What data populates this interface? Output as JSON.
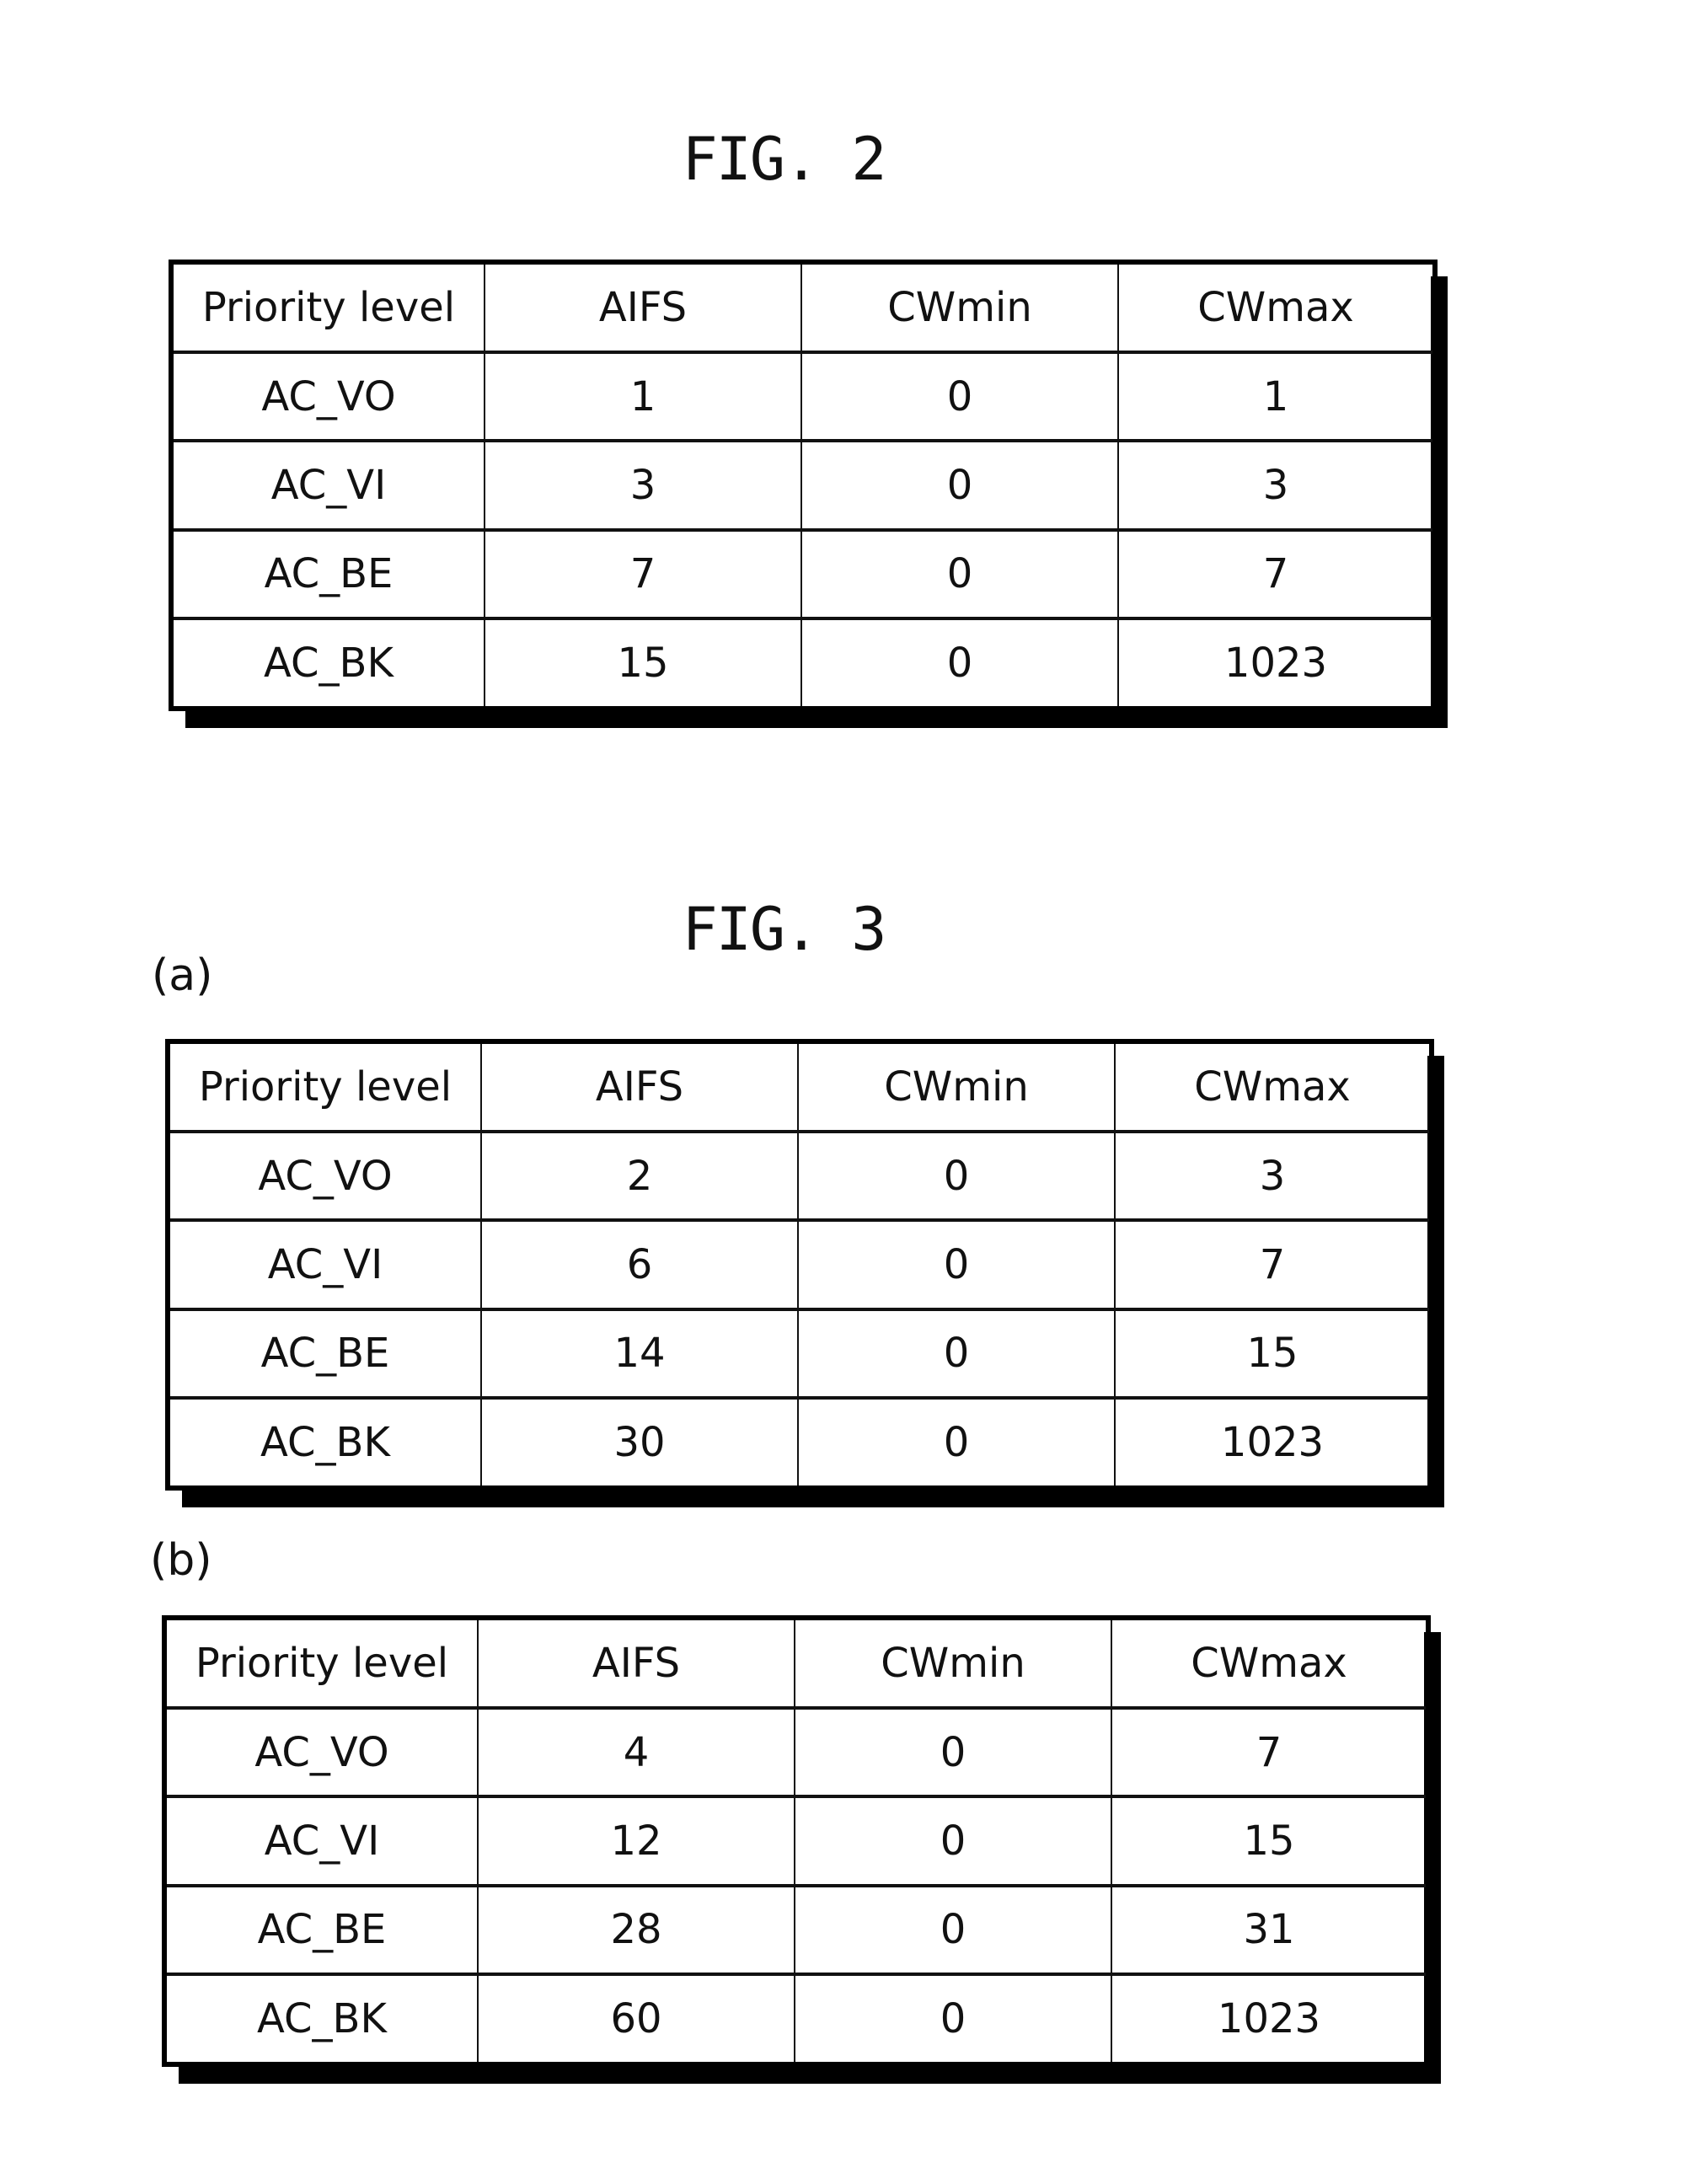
{
  "figures": [
    {
      "title": "FIG. 2",
      "panels": [
        {
          "label": "",
          "headers": [
            "Priority level",
            "AIFS",
            "CWmin",
            "CWmax"
          ],
          "rows": [
            [
              "AC_VO",
              "1",
              "0",
              "1"
            ],
            [
              "AC_VI",
              "3",
              "0",
              "3"
            ],
            [
              "AC_BE",
              "7",
              "0",
              "7"
            ],
            [
              "AC_BK",
              "15",
              "0",
              "1023"
            ]
          ]
        }
      ]
    },
    {
      "title": "FIG. 3",
      "panels": [
        {
          "label": "(a)",
          "headers": [
            "Priority level",
            "AIFS",
            "CWmin",
            "CWmax"
          ],
          "rows": [
            [
              "AC_VO",
              "2",
              "0",
              "3"
            ],
            [
              "AC_VI",
              "6",
              "0",
              "7"
            ],
            [
              "AC_BE",
              "14",
              "0",
              "15"
            ],
            [
              "AC_BK",
              "30",
              "0",
              "1023"
            ]
          ]
        },
        {
          "label": "(b)",
          "headers": [
            "Priority level",
            "AIFS",
            "CWmin",
            "CWmax"
          ],
          "rows": [
            [
              "AC_VO",
              "4",
              "0",
              "7"
            ],
            [
              "AC_VI",
              "12",
              "0",
              "15"
            ],
            [
              "AC_BE",
              "28",
              "0",
              "31"
            ],
            [
              "AC_BK",
              "60",
              "0",
              "1023"
            ]
          ]
        }
      ]
    }
  ]
}
